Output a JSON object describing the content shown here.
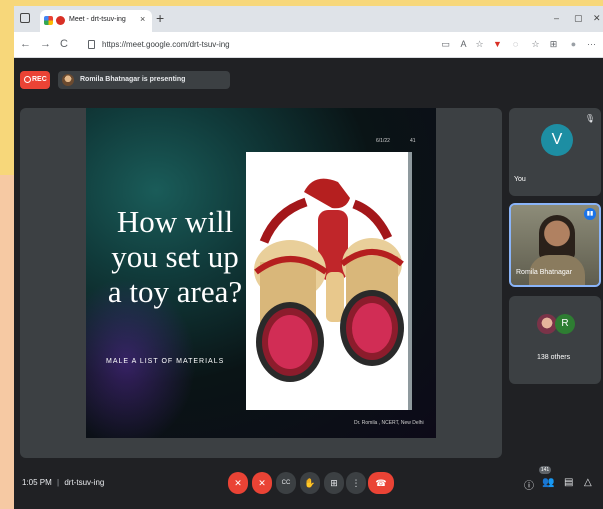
{
  "browser": {
    "tab_title": "Meet - drt-tsuv-ing",
    "tab_close": "×",
    "new_tab": "+",
    "window_controls": [
      "–",
      "▢",
      "✕"
    ],
    "nav": {
      "back": "←",
      "forward": "→",
      "reload": "C"
    },
    "url": "https://meet.google.com/drt-tsuv-ing",
    "toolbar_icons": [
      "screen-cast-icon",
      "read-aloud-icon",
      "extensions-icon",
      "shield-icon",
      "favorites-icon",
      "collections-icon",
      "profile-icon",
      "more-icon"
    ],
    "toolbar_glyphs": [
      "▭",
      "A",
      "☆",
      "▼",
      "◌",
      "☆",
      "⊞",
      "●",
      "···"
    ]
  },
  "meet": {
    "rec_label": "REC",
    "presenting_text": "Romila Bhatnagar is presenting",
    "slide": {
      "date": "6/1/22",
      "page": "41",
      "heading_lines": [
        "How will",
        "you set up",
        "a toy area?"
      ],
      "subtitle": "MALE A LIST OF MATERIALS",
      "credit": "Dr. Romila , NCERT, New Delhi"
    },
    "participants": {
      "you": {
        "initial": "V",
        "label": "You"
      },
      "presenter": {
        "label": "Romila Bhatnagar"
      },
      "others": {
        "initial": "R",
        "label": "138 others"
      }
    },
    "bottom": {
      "time": "1:05 PM",
      "separator": "|",
      "code": "drt-tsuv-ing",
      "participant_count": "141",
      "controls": [
        "mic-off-icon",
        "camera-off-icon",
        "captions-icon",
        "raise-hand-icon",
        "present-icon",
        "more-options-icon",
        "end-call-icon"
      ],
      "glyphs": {
        "mic": "✕",
        "cam": "✕",
        "cc": "CC",
        "hand": "✋",
        "present": "⊞",
        "more": "⋮",
        "end": "☎",
        "info": "ⓘ",
        "people": "👥",
        "chat": "▤",
        "activities": "△"
      }
    }
  }
}
